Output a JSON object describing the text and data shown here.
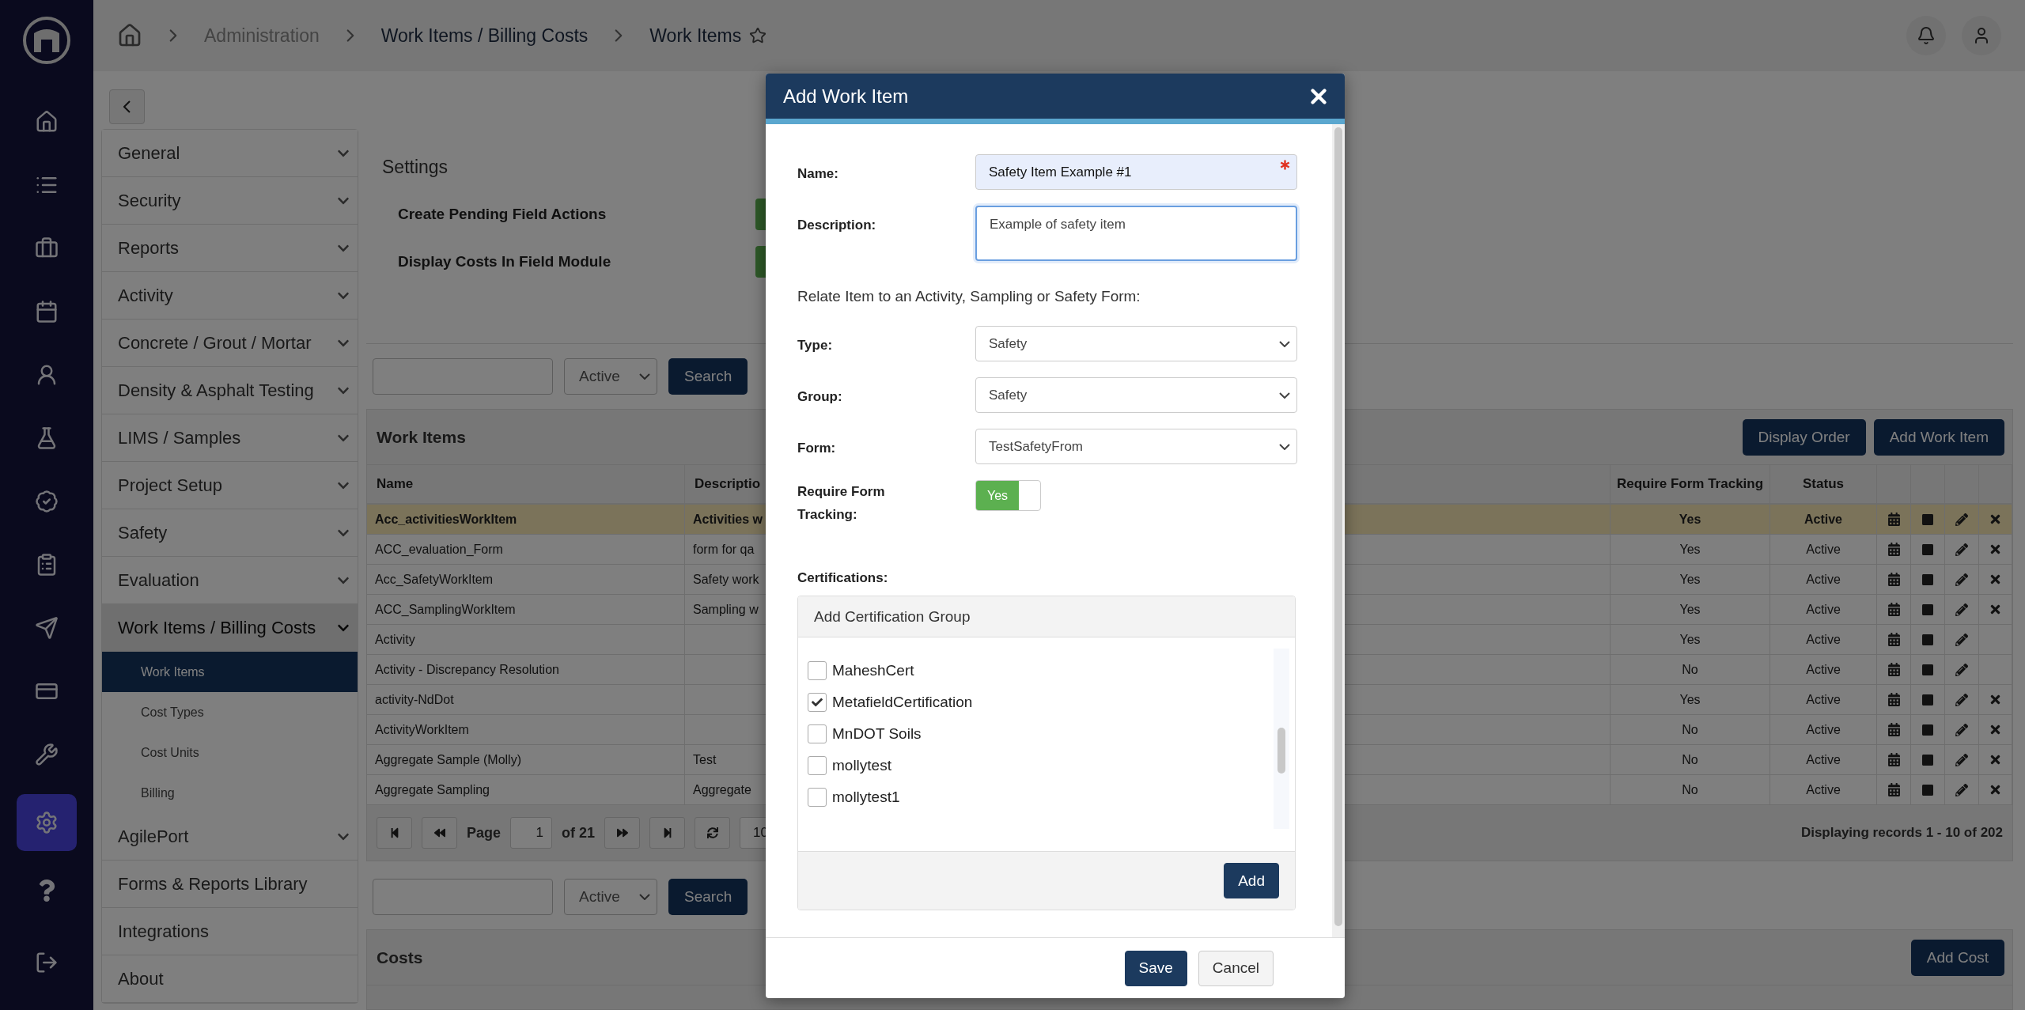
{
  "rail": {
    "items": [
      {
        "selected": false
      },
      {
        "selected": false
      },
      {
        "selected": false
      },
      {
        "selected": false
      },
      {
        "selected": false
      },
      {
        "selected": false
      },
      {
        "selected": false
      },
      {
        "selected": false
      },
      {
        "selected": false
      },
      {
        "selected": false
      },
      {
        "selected": false
      },
      {
        "selected": true
      },
      {
        "selected": false
      },
      {
        "selected": false
      }
    ]
  },
  "breadcrumb": {
    "items": [
      {
        "label": "Administration",
        "muted": true
      },
      {
        "label": "Work Items / Billing Costs",
        "muted": false
      },
      {
        "label": "Work Items",
        "muted": false
      }
    ],
    "favorite": false
  },
  "menu": {
    "items": [
      {
        "label": "General",
        "kind": "group",
        "expanded": false
      },
      {
        "label": "Security",
        "kind": "group",
        "expanded": false
      },
      {
        "label": "Reports",
        "kind": "group",
        "expanded": false
      },
      {
        "label": "Activity",
        "kind": "group",
        "expanded": false
      },
      {
        "label": "Concrete / Grout / Mortar",
        "kind": "group",
        "expanded": false
      },
      {
        "label": "Density & Asphalt Testing",
        "kind": "group",
        "expanded": false
      },
      {
        "label": "LIMS / Samples",
        "kind": "group",
        "expanded": false
      },
      {
        "label": "Project Setup",
        "kind": "group",
        "expanded": false
      },
      {
        "label": "Safety",
        "kind": "group",
        "expanded": false
      },
      {
        "label": "Evaluation",
        "kind": "group",
        "expanded": false
      },
      {
        "label": "Work Items / Billing Costs",
        "kind": "group",
        "expanded": true,
        "children": [
          {
            "label": "Work Items",
            "selected": true
          },
          {
            "label": "Cost Types",
            "selected": false
          },
          {
            "label": "Cost Units",
            "selected": false
          },
          {
            "label": "Billing",
            "selected": false
          }
        ]
      },
      {
        "label": "AgilePort",
        "kind": "group",
        "expanded": false
      },
      {
        "label": "Forms & Reports Library",
        "kind": "link"
      },
      {
        "label": "Integrations",
        "kind": "link"
      },
      {
        "label": "About",
        "kind": "link"
      }
    ]
  },
  "settings": {
    "title": "Settings",
    "options": [
      {
        "label": "Create Pending Field Actions",
        "on": true
      },
      {
        "label": "Display Costs In Field Module",
        "on": true
      }
    ]
  },
  "work_items_search": {
    "status": "Active",
    "button": "Search"
  },
  "work_items": {
    "title": "Work Items",
    "buttons": [
      "Display Order",
      "Add Work Item"
    ],
    "columns": [
      "Name",
      "Descriptio",
      "Require Form Tracking",
      "Status"
    ],
    "rows": [
      {
        "name": "Acc_activitiesWorkItem",
        "description": "Activities w",
        "require_form_tracking": "Yes",
        "status": "Active",
        "selected": true,
        "deletable": true
      },
      {
        "name": "ACC_evaluation_Form",
        "description": "form for qa",
        "require_form_tracking": "Yes",
        "status": "Active",
        "selected": false,
        "deletable": true
      },
      {
        "name": "Acc_SafetyWorkItem",
        "description": "Safety work",
        "require_form_tracking": "Yes",
        "status": "Active",
        "selected": false,
        "deletable": true
      },
      {
        "name": "ACC_SamplingWorkItem",
        "description": "Sampling w",
        "require_form_tracking": "Yes",
        "status": "Active",
        "selected": false,
        "deletable": true
      },
      {
        "name": "Activity",
        "require_form_tracking": "Yes",
        "status": "Active",
        "selected": false,
        "deletable": false
      },
      {
        "name": "Activity - Discrepancy Resolution",
        "require_form_tracking": "No",
        "status": "Active",
        "selected": false,
        "deletable": false
      },
      {
        "name": "activity-NdDot",
        "require_form_tracking": "Yes",
        "status": "Active",
        "selected": false,
        "deletable": true
      },
      {
        "name": "ActivityWorkItem",
        "require_form_tracking": "No",
        "status": "Active",
        "selected": false,
        "deletable": true
      },
      {
        "name": "Aggregate Sample (Molly)",
        "description": "Test",
        "require_form_tracking": "No",
        "status": "Active",
        "selected": false,
        "deletable": true
      },
      {
        "name": "Aggregate Sampling",
        "description": "Aggregate",
        "require_form_tracking": "No",
        "status": "Active",
        "selected": false,
        "deletable": true
      }
    ],
    "pager": {
      "page_label": "Page",
      "page": "1",
      "of": "of 21",
      "page_size": "10",
      "summary": "Displaying records 1 - 10 of 202"
    }
  },
  "costs_search": {
    "status": "Active",
    "button": "Search"
  },
  "costs": {
    "title": "Costs",
    "buttons": [
      "Add Cost"
    ]
  },
  "dialog": {
    "title": "Add Work Item",
    "name": {
      "label": "Name:",
      "value": "Safety Item Example #1",
      "required": true
    },
    "description": {
      "label": "Description:",
      "value": "Example of safety item",
      "focused": true
    },
    "relate_text": "Relate Item to an Activity, Sampling or Safety Form:",
    "selects": [
      {
        "label": "Type:",
        "value": "Safety"
      },
      {
        "label": "Group:",
        "value": "Safety"
      },
      {
        "label": "Form:",
        "value": "TestSafetyFrom"
      }
    ],
    "require_form_tracking": {
      "label": "Require Form Tracking:",
      "on": true,
      "on_label": "Yes"
    },
    "certifications": {
      "label": "Certifications:",
      "group_title": "Add Certification Group",
      "items": [
        {
          "label": "MaheshCert",
          "checked": false
        },
        {
          "label": "MetafieldCertification",
          "checked": true
        },
        {
          "label": "MnDOT Soils",
          "checked": false
        },
        {
          "label": "mollytest",
          "checked": false
        },
        {
          "label": "mollytest1",
          "checked": false
        }
      ],
      "add_button": "Add"
    },
    "buttons": [
      {
        "label": "Save",
        "kind": "primary"
      },
      {
        "label": "Cancel",
        "kind": "secondary"
      }
    ]
  }
}
